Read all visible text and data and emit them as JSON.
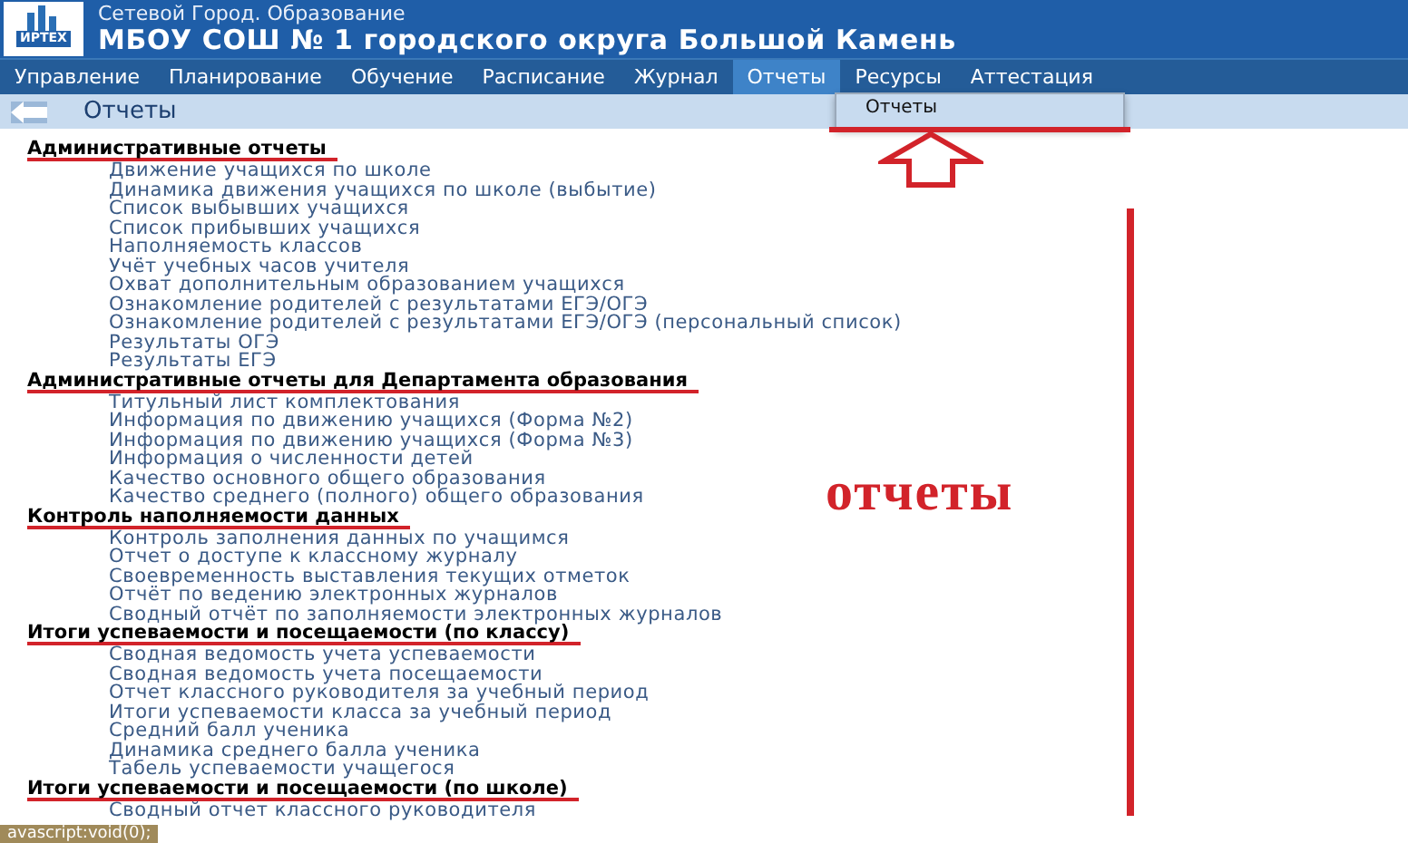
{
  "header": {
    "subtitle": "Сетевой Город. Образование",
    "title": "МБОУ СОШ № 1 городского округа Большой Камень",
    "logo_text": "ИРТЕХ"
  },
  "nav": [
    {
      "label": "Управление",
      "selected": false
    },
    {
      "label": "Планирование",
      "selected": false
    },
    {
      "label": "Обучение",
      "selected": false
    },
    {
      "label": "Расписание",
      "selected": false
    },
    {
      "label": "Журнал",
      "selected": false
    },
    {
      "label": "Отчеты",
      "selected": true
    },
    {
      "label": "Ресурсы",
      "selected": false
    },
    {
      "label": "Аттестация",
      "selected": false
    }
  ],
  "dropdown": {
    "items": [
      {
        "label": "Отчеты",
        "underlined": true
      }
    ]
  },
  "page_title": "Отчеты",
  "sections": [
    {
      "heading": "Административные отчеты",
      "underlined": true,
      "items": [
        "Движение учащихся по школе",
        "Динамика движения учащихся по школе (выбытие)",
        "Список выбывших учащихся",
        "Список прибывших учащихся",
        "Наполняемость классов",
        "Учёт учебных часов учителя",
        "Охват дополнительным образованием учащихся",
        "Ознакомление родителей с результатами ЕГЭ/ОГЭ",
        "Ознакомление родителей с результатами ЕГЭ/ОГЭ (персональный список)",
        "Результаты ОГЭ",
        "Результаты ЕГЭ"
      ]
    },
    {
      "heading": "Административные отчеты для Департамента образования",
      "underlined": true,
      "items": [
        "Титульный лист комплектования",
        "Информация по движению учащихся (Форма №2)",
        "Информация по движению учащихся (Форма №3)",
        "Информация о численности детей",
        "Качество основного общего образования",
        "Качество среднего (полного) общего образования"
      ]
    },
    {
      "heading": "Контроль наполняемости данных",
      "underlined": true,
      "items": [
        "Контроль заполнения данных по учащимся",
        "Отчет о доступе к классному журналу",
        "Своевременность выставления текущих отметок",
        "Отчёт по ведению электронных журналов",
        "Сводный отчёт по заполняемости электронных журналов"
      ]
    },
    {
      "heading": "Итоги успеваемости и посещаемости (по классу)",
      "underlined": true,
      "items": [
        "Сводная ведомость учета успеваемости",
        "Сводная ведомость учета посещаемости",
        "Отчет классного руководителя за учебный период",
        "Итоги успеваемости класса за учебный период",
        "Средний балл ученика",
        "Динамика среднего балла ученика",
        "Табель успеваемости учащегося"
      ]
    },
    {
      "heading": "Итоги успеваемости и посещаемости (по школе)",
      "underlined": true,
      "items": [
        "Сводный отчет классного руководителя"
      ]
    }
  ],
  "annotation": {
    "text": "отчеты"
  },
  "status_bar": "avascript:void(0);"
}
